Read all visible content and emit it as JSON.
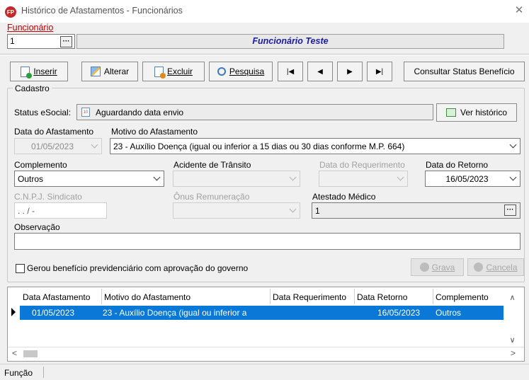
{
  "window": {
    "title": "Histórico de Afastamentos - Funcionários",
    "app_icon_text": "FP"
  },
  "employee": {
    "label": "Funcionário",
    "code": "1",
    "name": "Funcionário Teste"
  },
  "toolbar": {
    "insert": "Inserir",
    "edit": "Alterar",
    "delete": "Excluir",
    "search": "Pesquisa",
    "first": "|◀",
    "prev": "◀",
    "next": "▶",
    "last": "▶|",
    "status_benefit": "Consultar Status Benefício"
  },
  "cadastro": {
    "group_title": "Cadastro",
    "esocial_label": "Status eSocial:",
    "esocial_value": "Aguardando data envio",
    "history_button": "Ver histórico",
    "data_afastamento_label": "Data do Afastamento",
    "data_afastamento_value": "01/05/2023",
    "motivo_label": "Motivo do Afastamento",
    "motivo_value": "23  -  Auxílio Doença (igual ou inferior a 15 dias ou 30 dias conforme M.P. 664)",
    "complemento_label": "Complemento",
    "complemento_value": "Outros",
    "acidente_label": "Acidente de Trânsito",
    "data_requerimento_label": "Data do Requerimento",
    "data_retorno_label": "Data do Retorno",
    "data_retorno_value": "16/05/2023",
    "cnpj_label": "C.N.P.J. Sindicato",
    "cnpj_value": ". . /  -",
    "onus_label": "Ônus Remuneração",
    "atestado_label": "Atestado Médico",
    "atestado_value": "1",
    "observacao_label": "Observação",
    "checkbox_label": "Gerou benefício previdenciário com aprovação do governo",
    "save_button": "Grava",
    "cancel_button": "Cancela"
  },
  "grid": {
    "columns": [
      "Data Afastamento",
      "Motivo do Afastamento",
      "Data Requerimento",
      "Data Retorno",
      "Complemento"
    ],
    "rows": [
      {
        "data_afastamento": "01/05/2023",
        "motivo": "23  -  Auxílio Doença (igual ou inferior a",
        "data_requerimento": "",
        "data_retorno": "16/05/2023",
        "complemento": "Outros"
      }
    ]
  },
  "statusbar": {
    "field": "Função"
  },
  "colors": {
    "selection": "#0a78d7",
    "employee_name": "#1a1aa8",
    "label_accent": "#c00000"
  }
}
